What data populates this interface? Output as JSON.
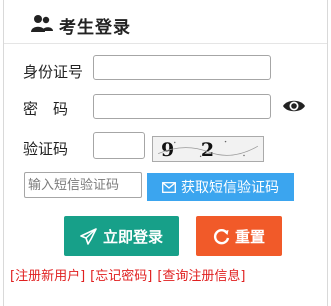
{
  "header": {
    "title": "考生登录",
    "icon": "user-group-icon"
  },
  "form": {
    "id_label": "身份证号",
    "id_value": "",
    "password_label": "密　码",
    "password_value": "",
    "password_toggle_icon": "eye-icon",
    "captcha_label": "验证码",
    "captcha_value": "",
    "captcha_text": "9 2 0 3",
    "sms_placeholder": "输入短信验证码",
    "sms_button_label": "获取短信验证码",
    "sms_button_icon": "mail-icon"
  },
  "actions": {
    "login_label": "立即登录",
    "login_icon": "send-icon",
    "reset_label": "重置",
    "reset_icon": "refresh-icon"
  },
  "links": {
    "register": "[注册新用户]",
    "forgot": "[忘记密码]",
    "query": "[查询注册信息]"
  },
  "colors": {
    "login": "#17a089",
    "reset": "#f15a29",
    "sms": "#3ba5ef",
    "link": "#e02020"
  }
}
